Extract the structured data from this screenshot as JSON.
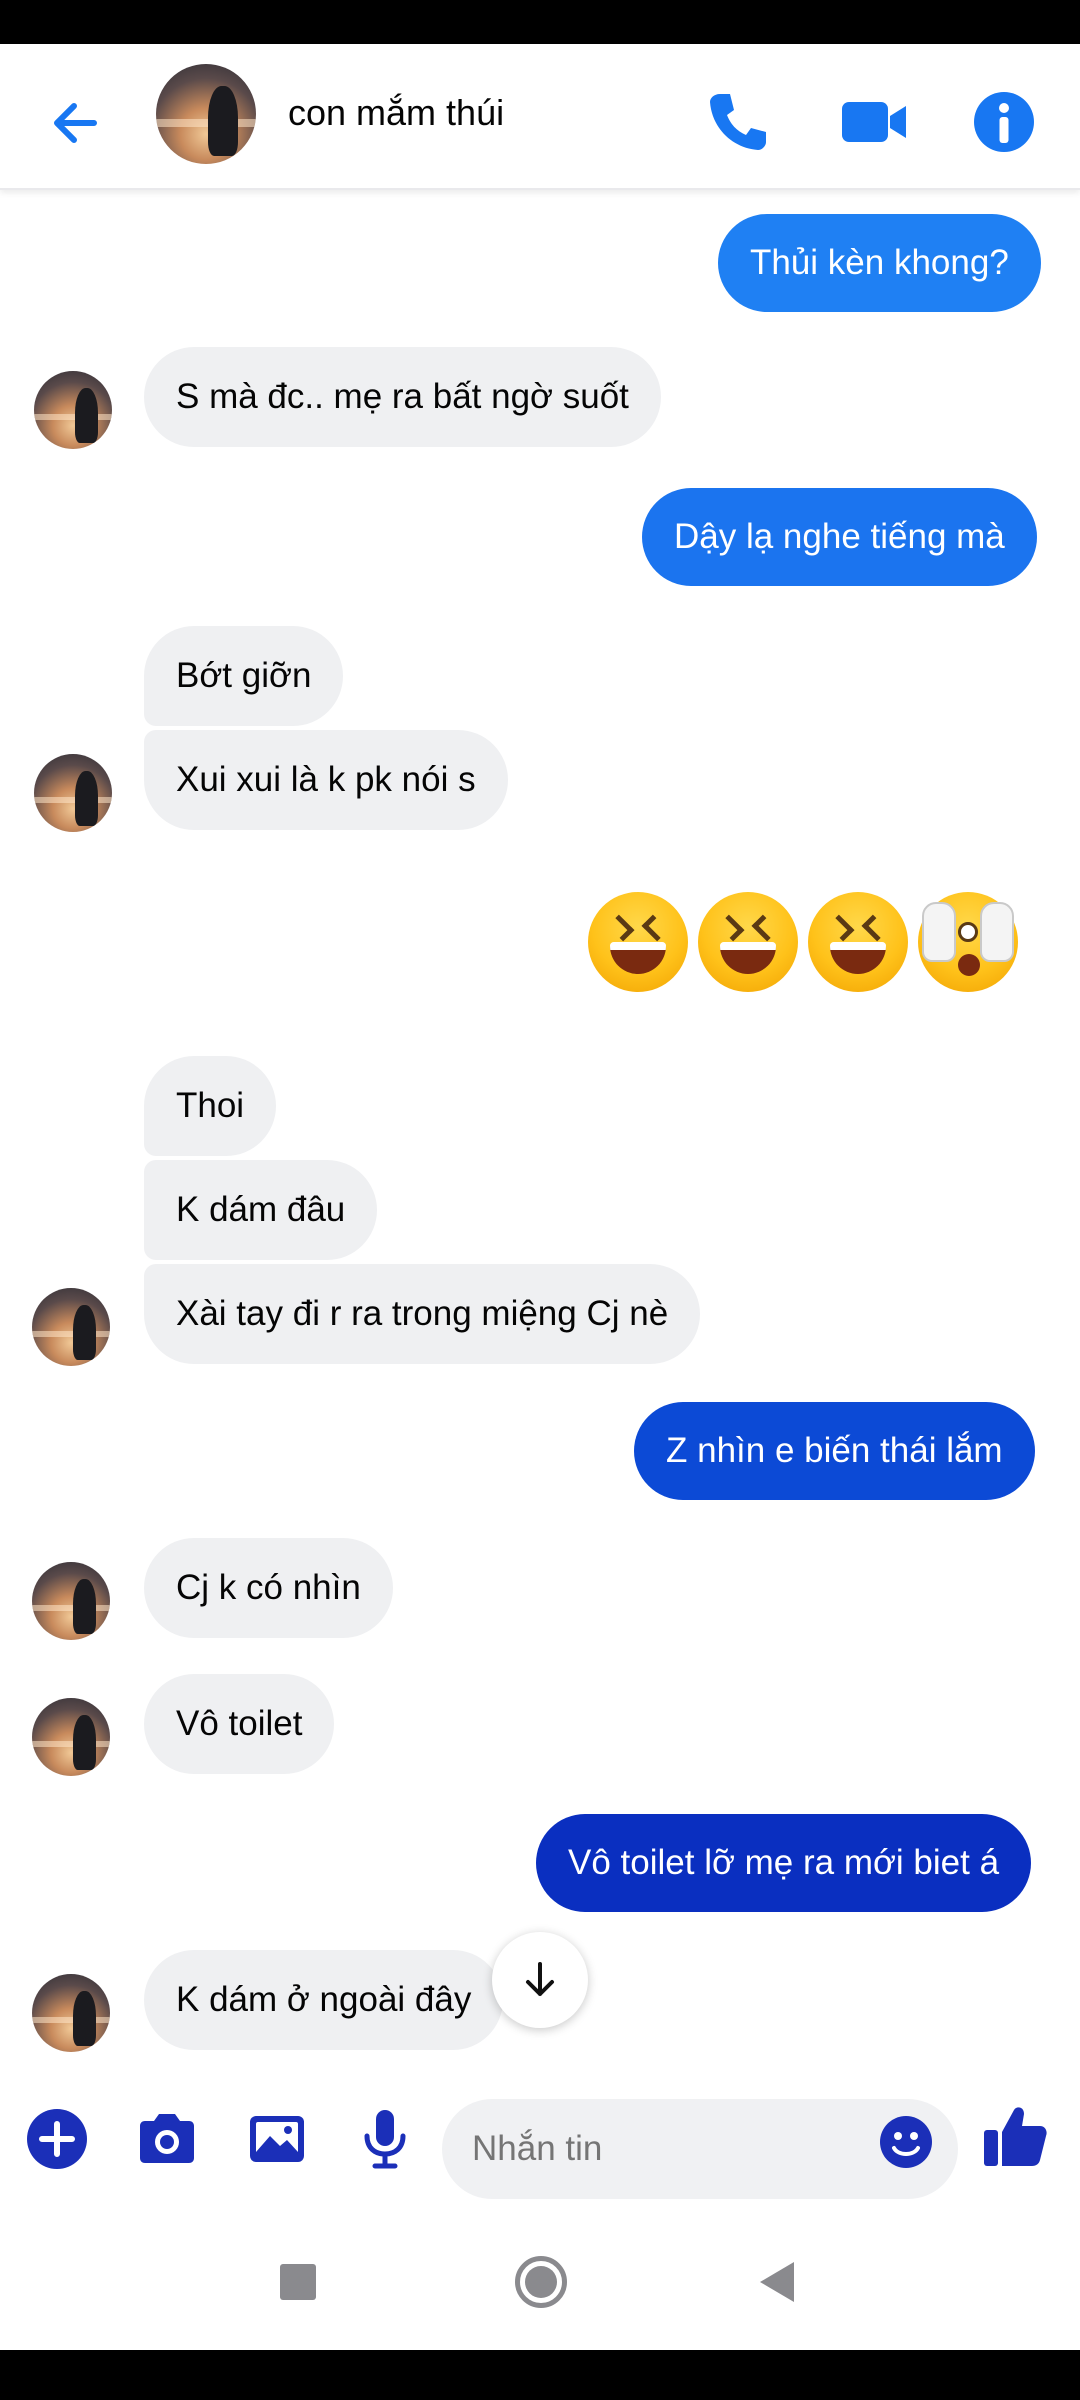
{
  "header": {
    "contact_name": "con mắm thúi",
    "icons": [
      "back-arrow-icon",
      "phone-icon",
      "video-camera-icon",
      "info-icon"
    ]
  },
  "messages": [
    {
      "from": "me",
      "text": "Thủi kèn khong?"
    },
    {
      "from": "them",
      "text": "S mà đc.. mẹ ra bất ngờ suốt"
    },
    {
      "from": "me",
      "text": "Dậy lạ nghe tiếng mà"
    },
    {
      "from": "them",
      "text": "Bớt giỡn"
    },
    {
      "from": "them",
      "text": "Xui xui là k pk nói s"
    },
    {
      "from": "me",
      "emoji": [
        "laughing-face",
        "laughing-face",
        "laughing-face",
        "face-covering-eyes"
      ]
    },
    {
      "from": "them",
      "text": "Thoi"
    },
    {
      "from": "them",
      "text": "K dám đâu"
    },
    {
      "from": "them",
      "text": "Xài tay đi r ra trong miệng Cj nè"
    },
    {
      "from": "me",
      "text": "Z nhìn e biến thái lắm"
    },
    {
      "from": "them",
      "text": "Cj k có nhìn"
    },
    {
      "from": "them",
      "text": "Vô toilet"
    },
    {
      "from": "me",
      "text": "Vô toilet lỡ mẹ ra mới biet á"
    },
    {
      "from": "them",
      "text": "K dám ở ngoài đây"
    }
  ],
  "composer": {
    "placeholder": "Nhắn tin",
    "icons": [
      "plus-icon",
      "camera-icon",
      "image-icon",
      "microphone-icon",
      "emoji-icon",
      "thumbs-up-icon"
    ]
  },
  "colors": {
    "out_top": "#1e7cf2",
    "out_mid": "#0b4fd6",
    "out_bottom": "#0a2fc2",
    "in_bubble": "#eff0f2",
    "accent": "#1877f2",
    "composer_icon": "#1b2fb8"
  }
}
